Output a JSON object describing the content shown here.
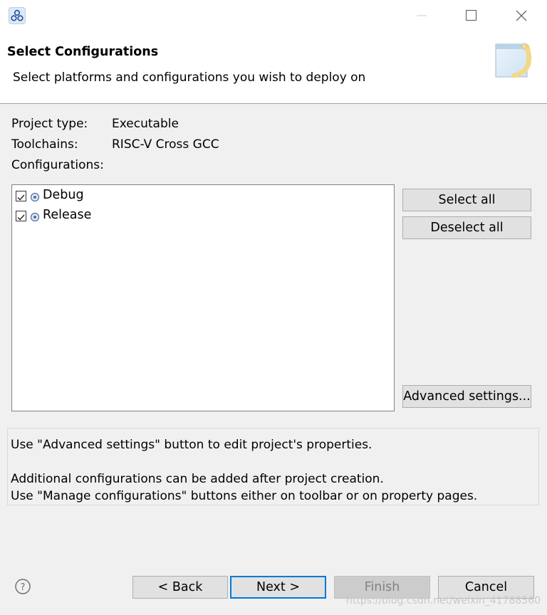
{
  "window": {
    "app_icon": "eclipse-cluster-icon",
    "controls": [
      "minimize-icon",
      "maximize-icon",
      "close-icon"
    ]
  },
  "header": {
    "title": "Select Configurations",
    "description": "Select platforms and configurations you wish to deploy on",
    "banner_icon": "wizard-banner-icon"
  },
  "info": {
    "project_type_label": "Project type:",
    "project_type_value": "Executable",
    "toolchains_label": "Toolchains:",
    "toolchains_value": "RISC-V Cross GCC",
    "configurations_label": "Configurations:"
  },
  "configurations": [
    {
      "label": "Debug",
      "checked": true,
      "icon": "config-gear-icon"
    },
    {
      "label": "Release",
      "checked": true,
      "icon": "config-gear-icon"
    }
  ],
  "buttons": {
    "select_all": "Select all",
    "deselect_all": "Deselect all",
    "advanced_settings": "Advanced settings..."
  },
  "info_box": {
    "line1": "Use \"Advanced settings\" button to edit project's properties.",
    "line2": "Additional configurations can be added after project creation.",
    "line3": "Use \"Manage configurations\" buttons either on toolbar or on property pages."
  },
  "footer": {
    "help_icon": "help-icon",
    "back": "< Back",
    "next": "Next >",
    "finish": "Finish",
    "cancel": "Cancel"
  },
  "watermark": "https://blog.csdn.net/weixin_41788560",
  "colors": {
    "accent": "#0078d7",
    "button_face": "#e1e1e1",
    "dialog_bg": "#f0f0f0"
  }
}
